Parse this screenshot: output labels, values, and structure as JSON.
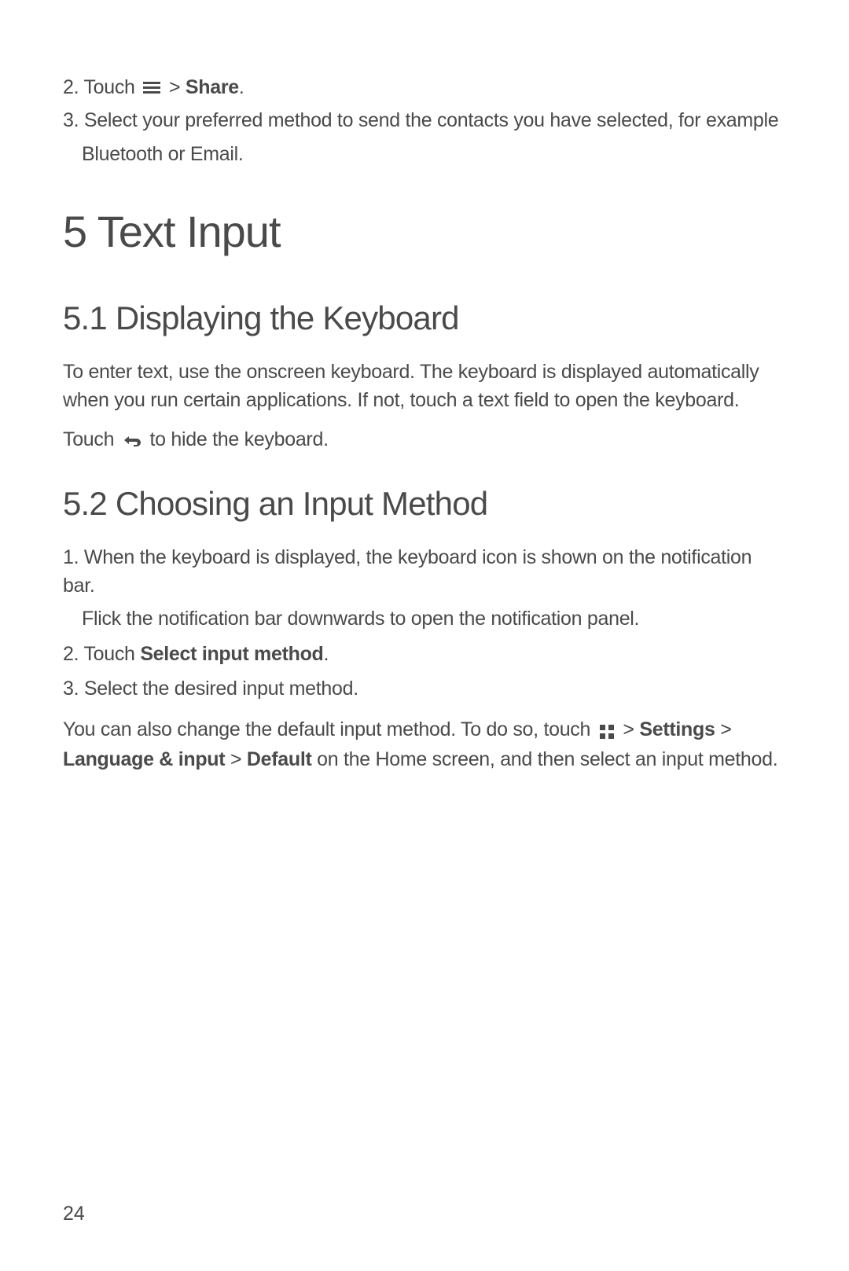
{
  "step2": {
    "prefix": "2. Touch ",
    "suffix": " > ",
    "bold": "Share",
    "end": "."
  },
  "step3": {
    "line1": "3. Select your preferred method to send the contacts you have selected, for example",
    "line2": "Bluetooth or Email."
  },
  "chapter": "5  Text Input",
  "section51": {
    "title": "5.1  Displaying the Keyboard",
    "para1": "To enter text, use the onscreen keyboard. The keyboard is displayed automatically when you run certain applications. If not, touch a text field to open the keyboard.",
    "hide_prefix": "Touch ",
    "hide_suffix": " to hide the keyboard."
  },
  "section52": {
    "title": "5.2  Choosing an Input Method",
    "step1_line1": "1. When the keyboard is displayed, the keyboard icon is shown on the notification bar.",
    "step1_line2": "Flick the notification bar downwards to open the notification panel.",
    "step2_prefix": "2. Touch ",
    "step2_bold": "Select input method",
    "step2_end": ".",
    "step3": "3. Select the desired input method.",
    "para_prefix": "You can also change the default input method. To do so, touch ",
    "para_sep1": "  > ",
    "settings": "Settings",
    "para_sep2": " > ",
    "langinput": "Language & input",
    "para_sep3": " > ",
    "default": "Default",
    "para_suffix": " on the Home screen, and then select an input method."
  },
  "page_number": "24"
}
